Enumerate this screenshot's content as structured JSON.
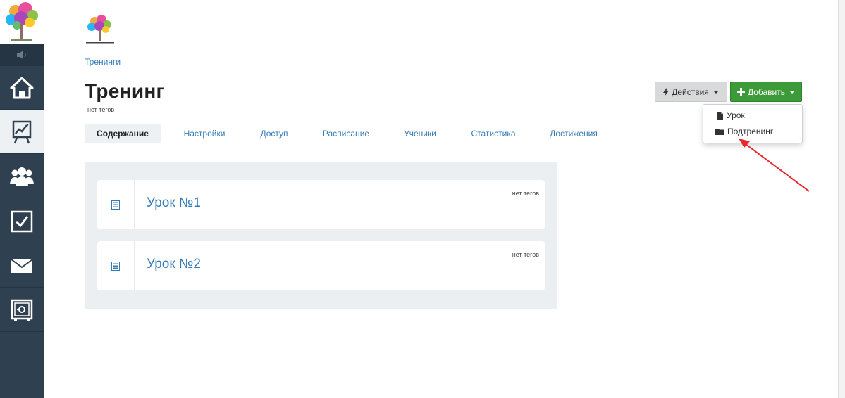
{
  "colors": {
    "sidebar_bg": "#2f4050",
    "link_blue": "#337ab7",
    "add_green": "#3d9a38",
    "arrow_red": "#e8262c"
  },
  "sidebar": {
    "items": [
      {
        "icon": "home-icon"
      },
      {
        "icon": "chart-board-icon",
        "active": true
      },
      {
        "icon": "users-icon"
      },
      {
        "icon": "checkbox-icon"
      },
      {
        "icon": "envelope-icon"
      },
      {
        "icon": "safe-icon"
      }
    ]
  },
  "breadcrumb": "Тренинги",
  "page": {
    "title": "Тренинг",
    "tags": "нет тегов"
  },
  "buttons": {
    "actions_label": "Действия",
    "add_label": "Добавить"
  },
  "dropdown": {
    "items": [
      {
        "label": "Урок",
        "icon": "file-icon"
      },
      {
        "label": "Подтренинг",
        "icon": "folder-icon"
      }
    ]
  },
  "tabs": [
    {
      "label": "Содержание",
      "active": true
    },
    {
      "label": "Настройки"
    },
    {
      "label": "Доступ"
    },
    {
      "label": "Расписание"
    },
    {
      "label": "Ученики"
    },
    {
      "label": "Статистика"
    },
    {
      "label": "Достижения"
    }
  ],
  "lessons": [
    {
      "title": "Урок №1",
      "tags": "нет тегов"
    },
    {
      "title": "Урок №2",
      "tags": "нет тегов"
    }
  ]
}
